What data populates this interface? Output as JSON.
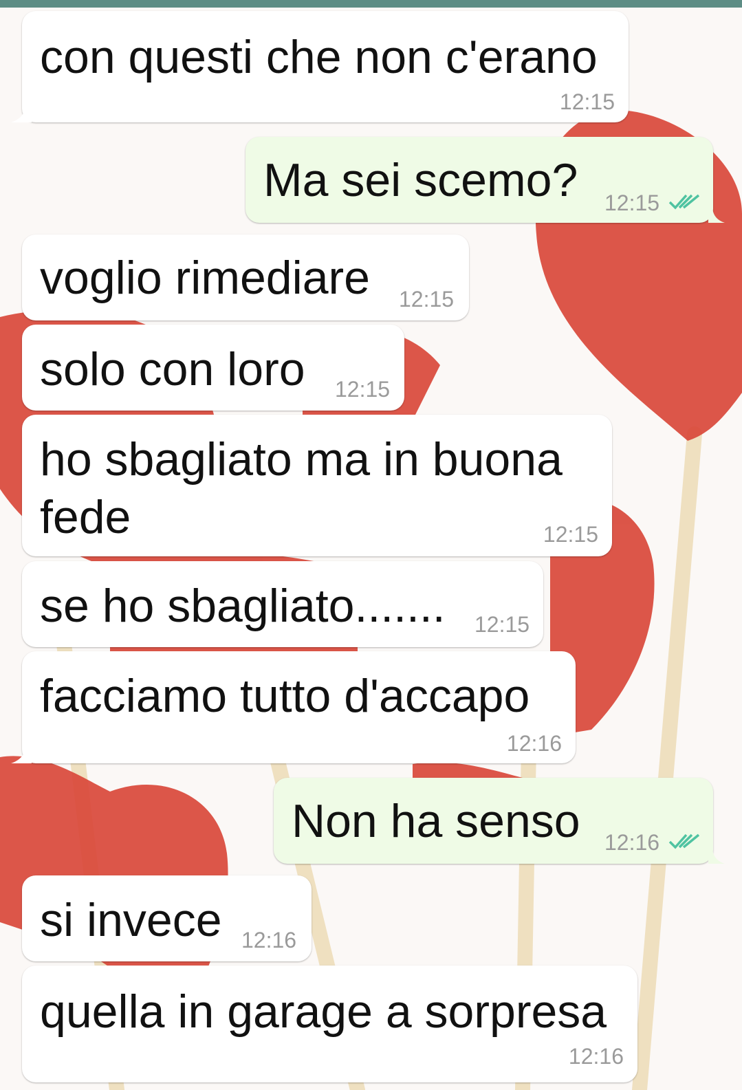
{
  "colors": {
    "incoming_bubble": "#ffffff",
    "outgoing_bubble": "#effbe6",
    "read_ticks": "#4fc3a1",
    "timestamp": "#9a9a9a",
    "top_bar": "#5d8d85",
    "wallpaper_hearts": "#d9483a"
  },
  "icons": {
    "read_receipt": "double-check-icon"
  },
  "messages": [
    {
      "direction": "incoming",
      "text": "con questi che non c'erano",
      "time": "12:15"
    },
    {
      "direction": "outgoing",
      "text": "Ma sei scemo?",
      "time": "12:15"
    },
    {
      "direction": "incoming",
      "text": "voglio rimediare",
      "time": "12:15"
    },
    {
      "direction": "incoming",
      "text": "solo con loro",
      "time": "12:15"
    },
    {
      "direction": "incoming",
      "line1": "ho sbagliato ma in buona",
      "line2": "fede",
      "time": "12:15"
    },
    {
      "direction": "incoming",
      "text": "se ho sbagliato.......",
      "time": "12:15"
    },
    {
      "direction": "incoming",
      "text": "facciamo tutto d'accapo",
      "time": "12:16"
    },
    {
      "direction": "outgoing",
      "text": "Non ha senso",
      "time": "12:16"
    },
    {
      "direction": "incoming",
      "text": "si invece",
      "time": "12:16"
    },
    {
      "direction": "incoming",
      "text": "quella in garage a sorpresa",
      "time": "12:16"
    }
  ]
}
